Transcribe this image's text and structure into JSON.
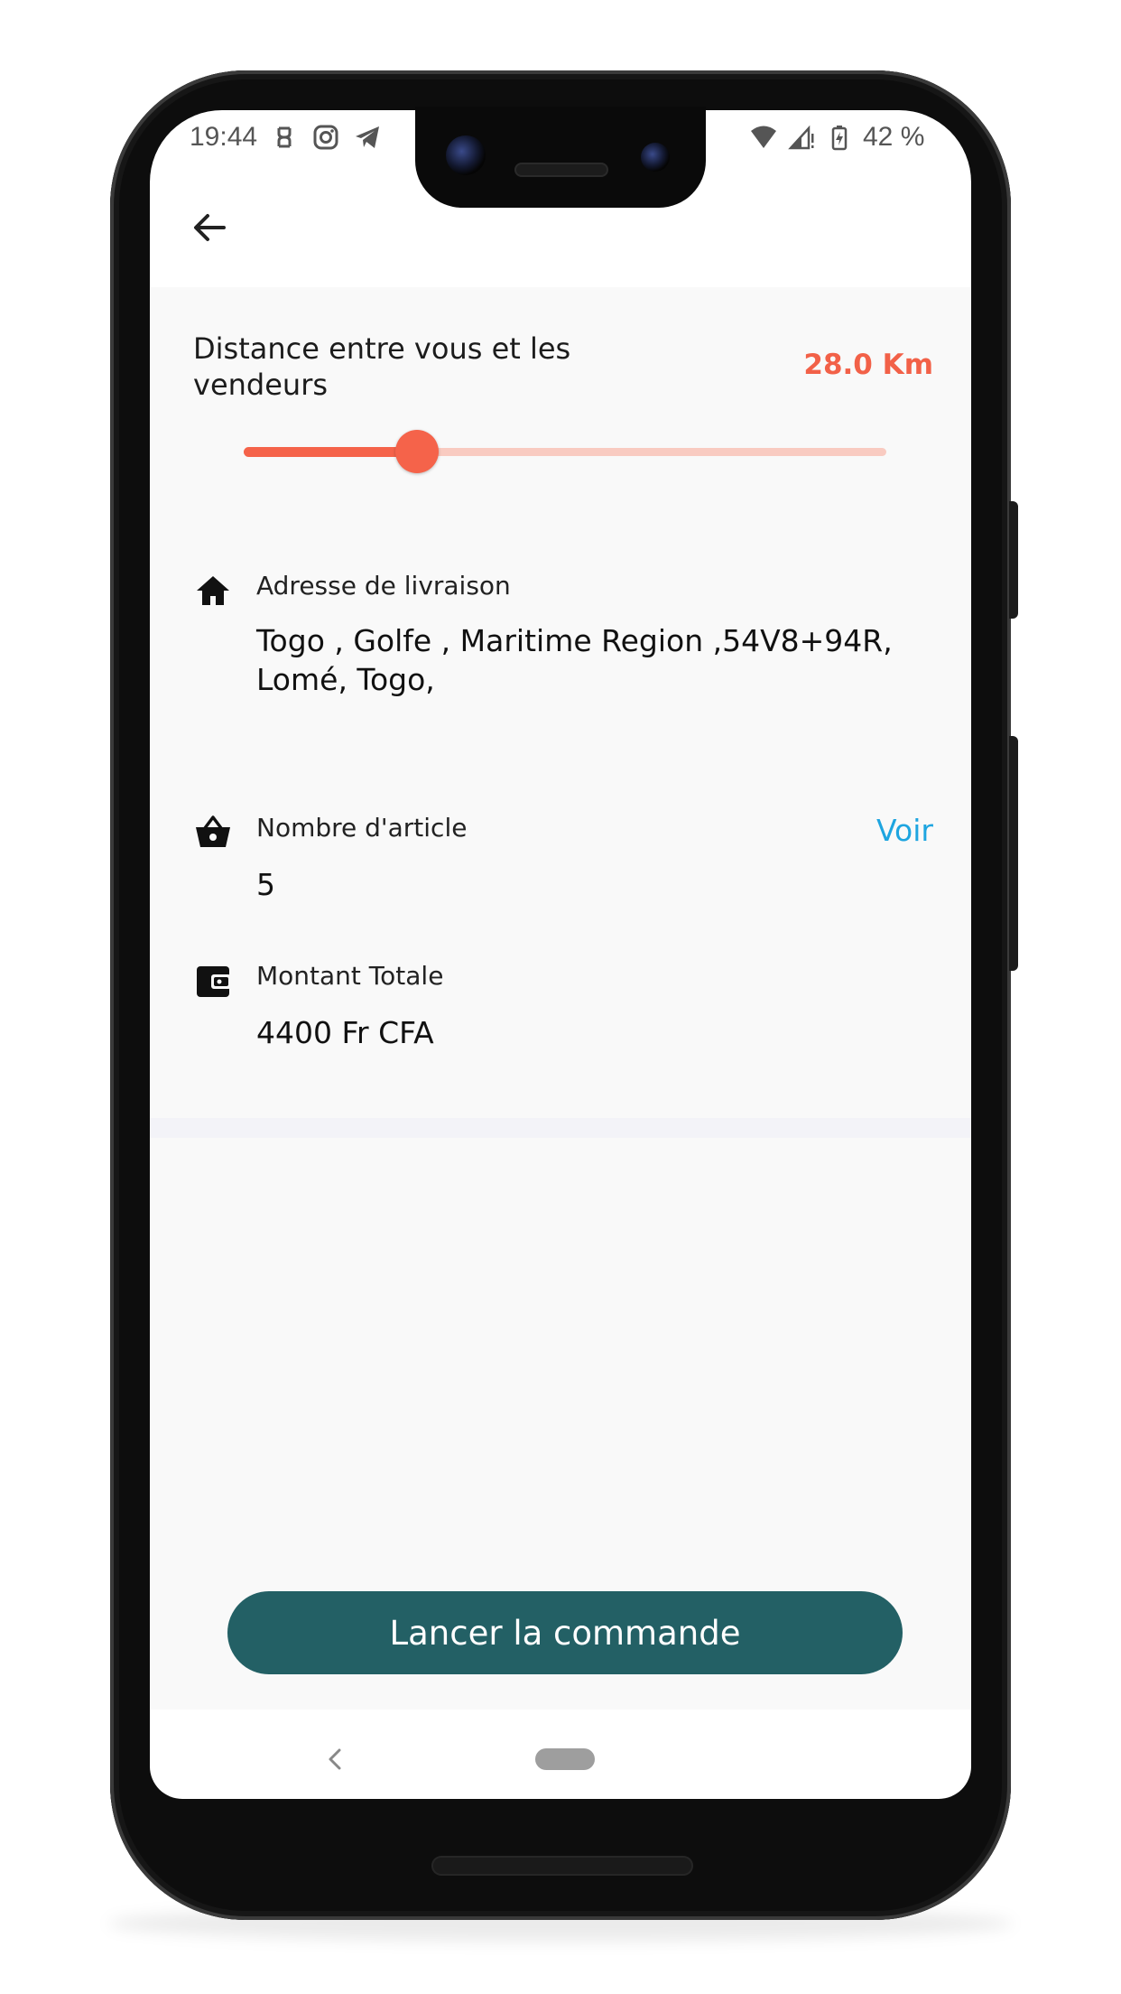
{
  "status_bar": {
    "time": "19:44",
    "battery": "42 %",
    "left_icons": [
      "notification-icon",
      "instagram-icon",
      "telegram-icon"
    ],
    "right_icons": [
      "wifi-icon",
      "signal-icon",
      "battery-icon"
    ]
  },
  "header": {
    "back_icon": "arrow-left-icon"
  },
  "distance": {
    "label": "Distance entre vous et les vendeurs",
    "value": "28.0 Km",
    "slider_fraction": 0.27,
    "accent_color": "#f5634a",
    "track_color": "#f9cbc1"
  },
  "delivery": {
    "icon": "home-icon",
    "label": "Adresse de livraison",
    "address_line1": "Togo , Golfe , Maritime Region ,54V8+94R,",
    "address_line2": "Lomé, Togo,"
  },
  "items": {
    "icon": "basket-icon",
    "label": "Nombre d'article",
    "count": "5",
    "link_label": "Voir",
    "link_color": "#1ea5e0"
  },
  "total": {
    "icon": "wallet-icon",
    "label": "Montant Totale",
    "amount": "4400 Fr CFA"
  },
  "cta": {
    "label": "Lancer la commande",
    "color": "#236065"
  },
  "nav_bar": {
    "back_icon": "nav-back-icon",
    "home_icon": "nav-home-pill"
  }
}
